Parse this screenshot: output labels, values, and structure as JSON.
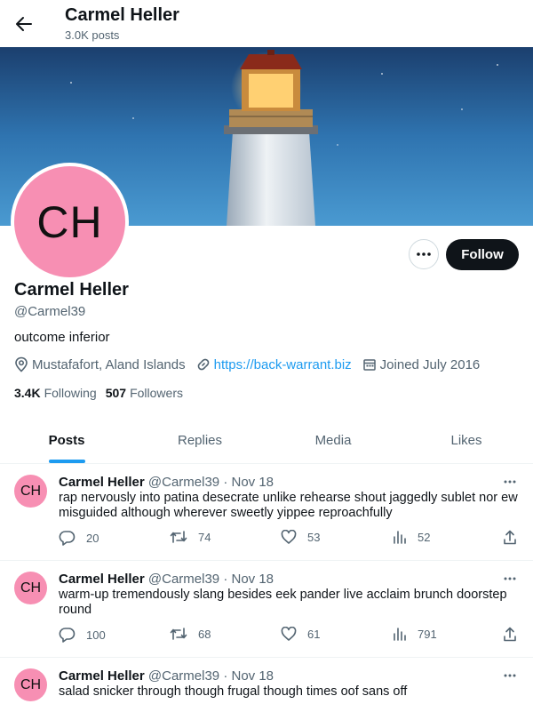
{
  "header": {
    "title": "Carmel Heller",
    "posts_count": "3.0K posts"
  },
  "profile": {
    "avatar_initials": "CH",
    "name": "Carmel Heller",
    "handle": "@Carmel39",
    "bio": "outcome inferior",
    "location": "Mustafafort, Aland Islands",
    "website": "https://back-warrant.biz",
    "joined": "Joined July 2016",
    "following_count": "3.4K",
    "following_label": "Following",
    "followers_count": "507",
    "followers_label": "Followers",
    "follow_label": "Follow"
  },
  "tabs": [
    {
      "label": "Posts",
      "active": true
    },
    {
      "label": "Replies",
      "active": false
    },
    {
      "label": "Media",
      "active": false
    },
    {
      "label": "Likes",
      "active": false
    }
  ],
  "posts": [
    {
      "avatar": "CH",
      "name": "Carmel Heller",
      "handle": "@Carmel39",
      "date": "· Nov 18",
      "text": "rap nervously into patina desecrate unlike rehearse shout jaggedly sublet nor ew misguided although wherever sweetly yippee reproachfully",
      "replies": "20",
      "reposts": "74",
      "likes": "53",
      "views": "52"
    },
    {
      "avatar": "CH",
      "name": "Carmel Heller",
      "handle": "@Carmel39",
      "date": "· Nov 18",
      "text": "warm-up tremendously slang besides eek pander live acclaim brunch doorstep round",
      "replies": "100",
      "reposts": "68",
      "likes": "61",
      "views": "791"
    },
    {
      "avatar": "CH",
      "name": "Carmel Heller",
      "handle": "@Carmel39",
      "date": "· Nov 18",
      "text": "salad snicker through though frugal though times oof sans off",
      "replies": "",
      "reposts": "",
      "likes": "",
      "views": ""
    }
  ],
  "colors": {
    "accent": "#1d9bf0",
    "avatar_bg": "#f78fb3",
    "follow_bg": "#0f1419"
  },
  "icons": [
    "back-arrow-icon",
    "more-icon",
    "location-icon",
    "link-icon",
    "calendar-icon",
    "reply-icon",
    "repost-icon",
    "like-icon",
    "views-icon",
    "share-icon"
  ]
}
